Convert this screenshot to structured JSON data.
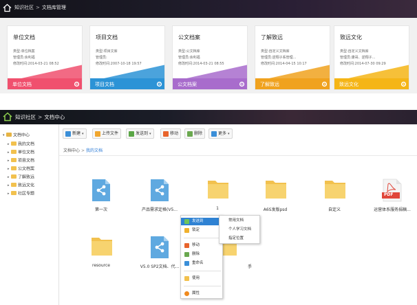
{
  "top_panel": {
    "breadcrumb": [
      "知识社区",
      "文档库管理"
    ],
    "cards": [
      {
        "title": "单位文档",
        "type": "类型:单位档案",
        "manager": "管理员:余利福",
        "modified": "修改时间:2014-03-21 08:52",
        "button": "单位文档",
        "color": "#f0506e"
      },
      {
        "title": "项目文档",
        "type": "类型:项目文库",
        "manager": "管理员:",
        "modified": "修改时间:2007-10-18 19:57",
        "button": "项目文档",
        "color": "#2c93d6"
      },
      {
        "title": "公文档案",
        "type": "类型:公文档库",
        "manager": "管理员:余利福",
        "modified": "修改时间:2014-03-21 08:55",
        "button": "公文档案",
        "color": "#a86ccc"
      },
      {
        "title": "了解致远",
        "type": "类型:自定义文档库",
        "manager": "管理员:逆翔子系管理...",
        "modified": "修改时间:2014-04-15 10:17",
        "button": "了解致远",
        "color": "#f0a21e"
      },
      {
        "title": "致远文化",
        "type": "类型:自定义文档库",
        "manager": "管理员:康哥、逆翔子...",
        "modified": "修改时间:2014-07-30 09:29",
        "button": "致远文化",
        "color": "#f5b516"
      }
    ]
  },
  "bottom_panel": {
    "breadcrumb": [
      "知识社区",
      "文档中心"
    ],
    "tree": {
      "root": "文档中心",
      "items": [
        "我的文档",
        "单位文档",
        "项目文档",
        "公文档案",
        "了解致远",
        "致远文化",
        "社区专题"
      ]
    },
    "toolbar": {
      "new": "新建",
      "upload": "上传文件",
      "send_to": "发送到",
      "move": "移动",
      "delete": "删除",
      "more": "更多"
    },
    "sub_breadcrumb": [
      "文档中心",
      "我的文档"
    ],
    "files": [
      {
        "name": "第一次",
        "kind": "doc"
      },
      {
        "name": "产品需求定格(V5...",
        "kind": "doc"
      },
      {
        "name": "1",
        "kind": "folder"
      },
      {
        "name": "A6S发版psd",
        "kind": "folder"
      },
      {
        "name": "自定义",
        "kind": "folder"
      },
      {
        "name": "运营体系服务捐稿...",
        "kind": "pdf"
      },
      {
        "name": "resource",
        "kind": "folder"
      },
      {
        "name": "V5.0 SP2文档、代...",
        "kind": "doc"
      },
      {
        "name": "手",
        "kind": "folder"
      }
    ],
    "pdf_badge": "PDF",
    "context_menu": {
      "items": [
        "发送到",
        "锁定",
        "移动",
        "删除",
        "重命名",
        "使用",
        "属性"
      ],
      "submenu": [
        "常用文档",
        "个人学习文档",
        "指定位置"
      ]
    }
  }
}
